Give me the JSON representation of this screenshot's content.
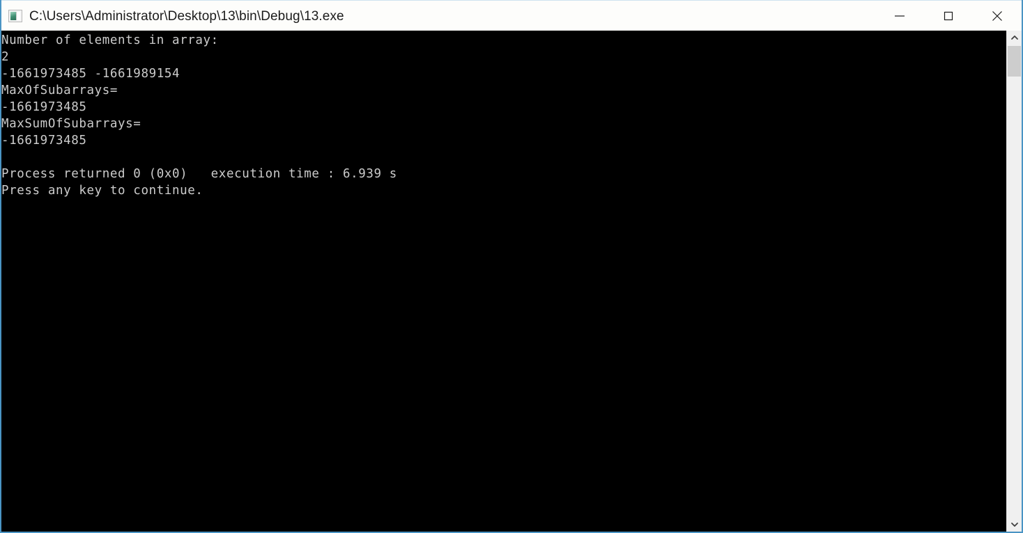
{
  "window": {
    "title": "C:\\Users\\Administrator\\Desktop\\13\\bin\\Debug\\13.exe",
    "icon": "console-app-icon",
    "border_color": "#4a94c4",
    "titlebar_bg": "#fdfdfb",
    "titlebar_text_color": "#1b1b1b"
  },
  "caption_buttons": {
    "minimize": {
      "name": "minimize-button",
      "glyph": "minimize-icon",
      "label": "Minimize"
    },
    "maximize": {
      "name": "maximize-button",
      "glyph": "maximize-icon",
      "label": "Maximize"
    },
    "close": {
      "name": "close-button",
      "glyph": "close-icon",
      "label": "Close"
    }
  },
  "console": {
    "background": "#000000",
    "foreground": "#cccccc",
    "lines": [
      "Number of elements in array:",
      "2",
      "-1661973485 -1661989154",
      "MaxOfSubarrays=",
      "-1661973485",
      "MaxSumOfSubarrays=",
      "-1661973485",
      "",
      "Process returned 0 (0x0)   execution time : 6.939 s",
      "Press any key to continue."
    ],
    "text": "Number of elements in array:\n2\n-1661973485 -1661989154\nMaxOfSubarrays=\n-1661973485\nMaxSumOfSubarrays=\n-1661973485\n\nProcess returned 0 (0x0)   execution time : 6.939 s\nPress any key to continue.",
    "prompt_values": {
      "element_count": "2",
      "array_values": [
        "-1661973485",
        "-1661989154"
      ],
      "max_of_subarrays": "-1661973485",
      "max_sum_of_subarrays": "-1661973485",
      "return_code": "0 (0x0)",
      "execution_time": "6.939 s"
    }
  },
  "scrollbar": {
    "up_arrow": "chevron-up-icon",
    "down_arrow": "chevron-down-icon",
    "track_color": "#f0f0f0",
    "thumb_color": "#cdcdcd"
  }
}
